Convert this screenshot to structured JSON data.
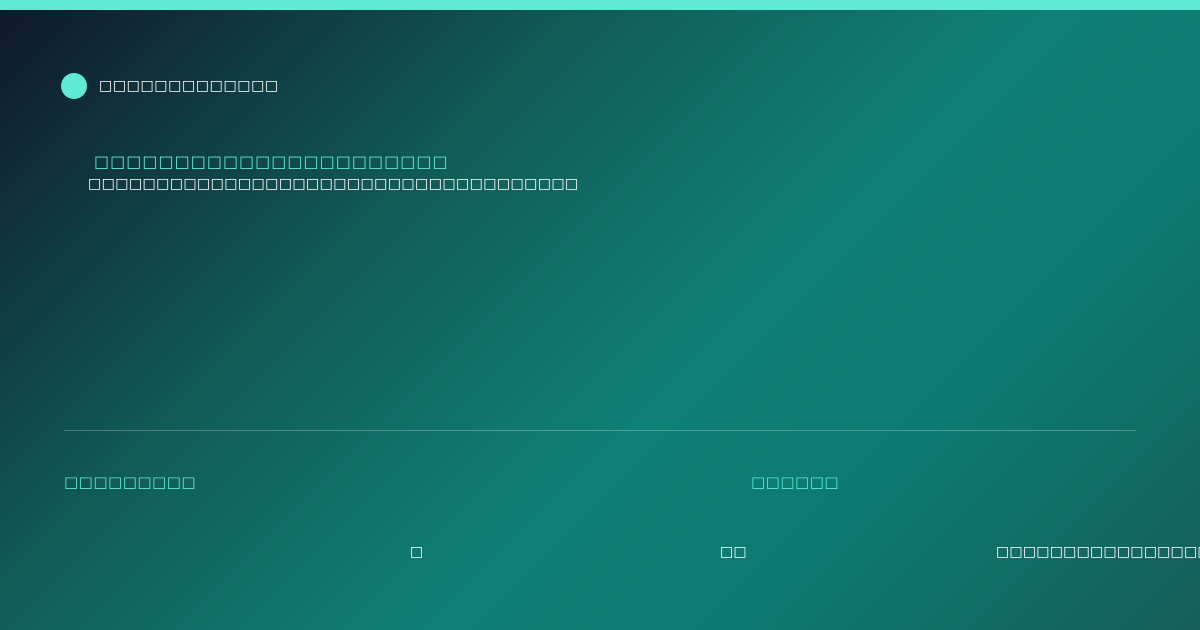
{
  "colors": {
    "accent": "#5eead4",
    "text": "#ffffff"
  },
  "header": {
    "brand_icon": "circle-logo",
    "brand_text": "□□□□□□□□□□□□□"
  },
  "hero": {
    "title": "□□□□□□□□□□□□□□□□□□□□□□",
    "subtitle": "□□□□□□□□□□□□□□□□□□□□□□□□□□□□□□□□□□□□"
  },
  "footer": {
    "left_label": "□□□□□□□□□",
    "right_label": "□□□□□□",
    "meta_items": [
      "□",
      "□□",
      "□□□□□□□□□□□□□□□□□□□"
    ]
  }
}
